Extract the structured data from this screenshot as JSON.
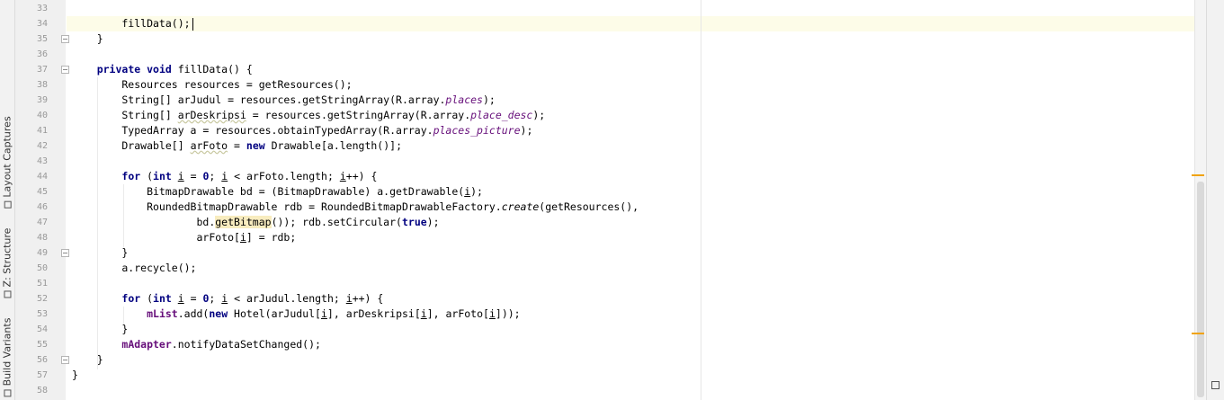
{
  "tool_windows": {
    "layout_captures": "Layout Captures",
    "structure": "Z: Structure",
    "build_variants": "Build Variants",
    "layout_captures_icon": "camera-icon",
    "structure_icon": "structure-icon",
    "build_variants_icon": "build-variants-icon"
  },
  "editor": {
    "current_line": 34,
    "line_numbers": [
      "33",
      "34",
      "35",
      "36",
      "37",
      "38",
      "39",
      "40",
      "41",
      "42",
      "43",
      "44",
      "45",
      "46",
      "47",
      "48",
      "49",
      "50",
      "51",
      "52",
      "53",
      "54",
      "55",
      "56",
      "57",
      "58"
    ],
    "fold_lines": [
      35,
      37,
      49,
      56
    ],
    "lines": [
      {
        "n": "33",
        "segs": []
      },
      {
        "n": "34",
        "segs": [
          {
            "t": "        fillData();"
          }
        ],
        "caret": true
      },
      {
        "n": "35",
        "segs": [
          {
            "t": "    }"
          }
        ]
      },
      {
        "n": "36",
        "segs": []
      },
      {
        "n": "37",
        "segs": [
          {
            "t": "    "
          },
          {
            "t": "private void",
            "c": "kw"
          },
          {
            "t": " fillData() {"
          }
        ]
      },
      {
        "n": "38",
        "segs": [
          {
            "t": "        Resources resources = getResources();"
          }
        ]
      },
      {
        "n": "39",
        "segs": [
          {
            "t": "        String[] arJudul = resources.getStringArray(R.array."
          },
          {
            "t": "places",
            "c": "res"
          },
          {
            "t": ");"
          }
        ]
      },
      {
        "n": "40",
        "segs": [
          {
            "t": "        String[] "
          },
          {
            "t": "arDeskripsi",
            "c": "warn-ul"
          },
          {
            "t": " = resources.getStringArray(R.array."
          },
          {
            "t": "place_desc",
            "c": "res"
          },
          {
            "t": ");"
          }
        ]
      },
      {
        "n": "41",
        "segs": [
          {
            "t": "        TypedArray a = resources.obtainTypedArray(R.array."
          },
          {
            "t": "places_picture",
            "c": "res"
          },
          {
            "t": ");"
          }
        ]
      },
      {
        "n": "42",
        "segs": [
          {
            "t": "        Drawable[] "
          },
          {
            "t": "arFoto",
            "c": "warn-ul"
          },
          {
            "t": " = "
          },
          {
            "t": "new",
            "c": "kw"
          },
          {
            "t": " Drawable[a.length()];"
          }
        ]
      },
      {
        "n": "43",
        "segs": []
      },
      {
        "n": "44",
        "segs": [
          {
            "t": "        "
          },
          {
            "t": "for",
            "c": "kw"
          },
          {
            "t": " ("
          },
          {
            "t": "int",
            "c": "kw"
          },
          {
            "t": " "
          },
          {
            "t": "i",
            "c": "ul"
          },
          {
            "t": " = "
          },
          {
            "t": "0",
            "c": "kw"
          },
          {
            "t": "; "
          },
          {
            "t": "i",
            "c": "ul"
          },
          {
            "t": " < arFoto.length; "
          },
          {
            "t": "i",
            "c": "ul"
          },
          {
            "t": "++) {"
          }
        ]
      },
      {
        "n": "45",
        "segs": [
          {
            "t": "            BitmapDrawable bd = (BitmapDrawable) a.getDrawable("
          },
          {
            "t": "i",
            "c": "ul"
          },
          {
            "t": ");"
          }
        ]
      },
      {
        "n": "46",
        "segs": [
          {
            "t": "            RoundedBitmapDrawable rdb = RoundedBitmapDrawableFactory."
          },
          {
            "t": "create",
            "c": "ital"
          },
          {
            "t": "(getResources(),"
          }
        ]
      },
      {
        "n": "47",
        "segs": [
          {
            "t": "                    bd."
          },
          {
            "t": "getBitmap",
            "c": "hl"
          },
          {
            "t": "()); rdb.setCircular("
          },
          {
            "t": "true",
            "c": "kw"
          },
          {
            "t": ");"
          }
        ]
      },
      {
        "n": "48",
        "segs": [
          {
            "t": "                    arFoto["
          },
          {
            "t": "i",
            "c": "ul"
          },
          {
            "t": "] = rdb;"
          }
        ]
      },
      {
        "n": "49",
        "segs": [
          {
            "t": "        }"
          }
        ]
      },
      {
        "n": "50",
        "segs": [
          {
            "t": "        a.recycle();"
          }
        ]
      },
      {
        "n": "51",
        "segs": []
      },
      {
        "n": "52",
        "segs": [
          {
            "t": "        "
          },
          {
            "t": "for",
            "c": "kw"
          },
          {
            "t": " ("
          },
          {
            "t": "int",
            "c": "kw"
          },
          {
            "t": " "
          },
          {
            "t": "i",
            "c": "ul"
          },
          {
            "t": " = "
          },
          {
            "t": "0",
            "c": "kw"
          },
          {
            "t": "; "
          },
          {
            "t": "i",
            "c": "ul"
          },
          {
            "t": " < arJudul.length; "
          },
          {
            "t": "i",
            "c": "ul"
          },
          {
            "t": "++) {"
          }
        ]
      },
      {
        "n": "53",
        "segs": [
          {
            "t": "            "
          },
          {
            "t": "mList",
            "c": "fld"
          },
          {
            "t": ".add("
          },
          {
            "t": "new",
            "c": "kw"
          },
          {
            "t": " Hotel(arJudul["
          },
          {
            "t": "i",
            "c": "ul"
          },
          {
            "t": "], arDeskripsi["
          },
          {
            "t": "i",
            "c": "ul"
          },
          {
            "t": "], arFoto["
          },
          {
            "t": "i",
            "c": "ul"
          },
          {
            "t": "]));"
          }
        ]
      },
      {
        "n": "54",
        "segs": [
          {
            "t": "        }"
          }
        ]
      },
      {
        "n": "55",
        "segs": [
          {
            "t": "        "
          },
          {
            "t": "mAdapter",
            "c": "fld"
          },
          {
            "t": ".notifyDataSetChanged();"
          }
        ]
      },
      {
        "n": "56",
        "segs": [
          {
            "t": "    }"
          }
        ]
      },
      {
        "n": "57",
        "segs": [
          {
            "t": "}"
          }
        ]
      },
      {
        "n": "58",
        "segs": []
      }
    ]
  },
  "colors": {
    "keyword": "#000080",
    "field": "#660e7a",
    "current_line_bg": "#fdfce8",
    "warning_marker": "#f0a30a"
  }
}
